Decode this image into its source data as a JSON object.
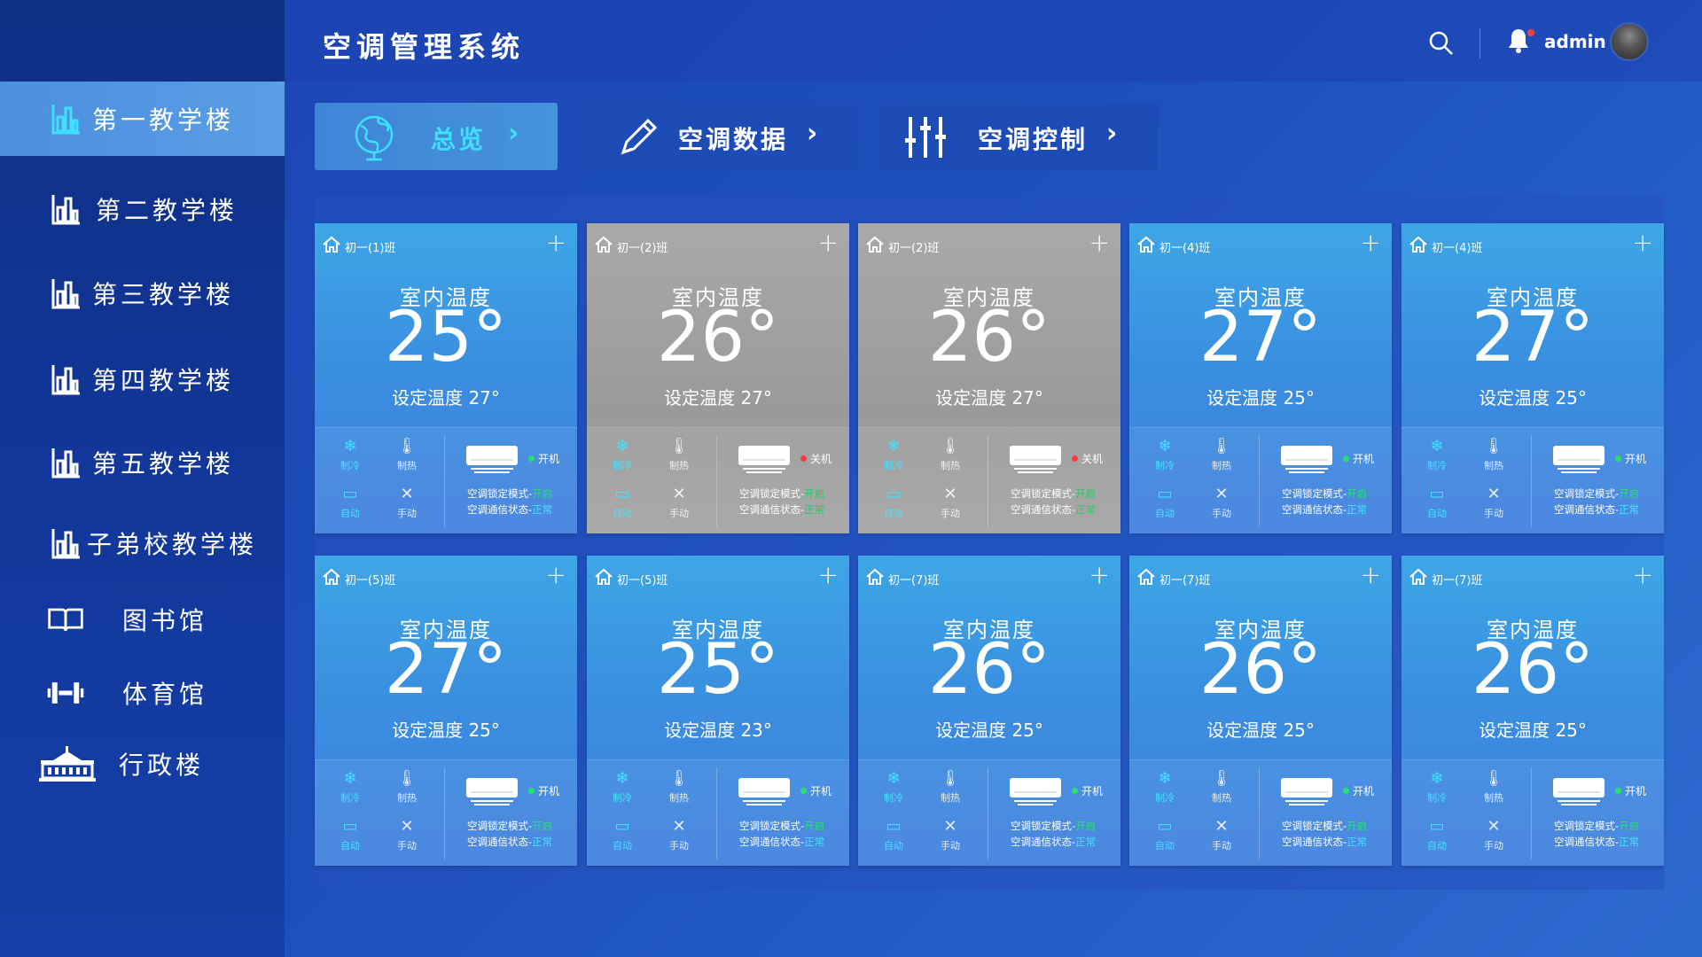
{
  "app": {
    "title": "空调管理系统",
    "user": "admin"
  },
  "sidebar": {
    "items": [
      {
        "label": "第一教学楼",
        "icon": "bar-chart-icon",
        "active": true
      },
      {
        "label": "第二教学楼",
        "icon": "bar-chart-icon"
      },
      {
        "label": "第三教学楼",
        "icon": "bar-chart-icon"
      },
      {
        "label": "第四教学楼",
        "icon": "bar-chart-icon"
      },
      {
        "label": "第五教学楼",
        "icon": "bar-chart-icon"
      },
      {
        "label": "子弟校教学楼",
        "icon": "bar-chart-icon"
      },
      {
        "label": "图书馆",
        "icon": "book-icon"
      },
      {
        "label": "体育馆",
        "icon": "dumbbell-icon"
      },
      {
        "label": "行政楼",
        "icon": "building-icon"
      }
    ]
  },
  "tabs": [
    {
      "label": "总览",
      "icon": "globe-icon",
      "active": true
    },
    {
      "label": "空调数据",
      "icon": "pencil-icon"
    },
    {
      "label": "空调控制",
      "icon": "sliders-icon"
    }
  ],
  "card_labels": {
    "indoor": "室内温度",
    "set_prefix": "设定温度",
    "cool": "制冷",
    "heat": "制热",
    "auto": "自动",
    "manual": "手动",
    "lock_prefix": "空调锁定模式-",
    "lock_value": "开启",
    "comm_prefix": "空调通信状态-",
    "comm_value": "正常"
  },
  "cards": [
    {
      "class": "初一(1)班",
      "temp": "25°",
      "set": "27°",
      "power": "开机",
      "on": true
    },
    {
      "class": "初一(2)班",
      "temp": "26°",
      "set": "27°",
      "power": "关机",
      "on": false
    },
    {
      "class": "初一(2)班",
      "temp": "26°",
      "set": "27°",
      "power": "关机",
      "on": false
    },
    {
      "class": "初一(4)班",
      "temp": "27°",
      "set": "25°",
      "power": "开机",
      "on": true
    },
    {
      "class": "初一(4)班",
      "temp": "27°",
      "set": "25°",
      "power": "开机",
      "on": true
    },
    {
      "class": "初一(5)班",
      "temp": "27°",
      "set": "25°",
      "power": "开机",
      "on": true
    },
    {
      "class": "初一(5)班",
      "temp": "25°",
      "set": "23°",
      "power": "开机",
      "on": true
    },
    {
      "class": "初一(7)班",
      "temp": "26°",
      "set": "25°",
      "power": "开机",
      "on": true
    },
    {
      "class": "初一(7)班",
      "temp": "26°",
      "set": "25°",
      "power": "开机",
      "on": true
    },
    {
      "class": "初一(7)班",
      "temp": "26°",
      "set": "25°",
      "power": "开机",
      "on": true
    }
  ],
  "colors": {
    "accent_cyan": "#3fe0ff",
    "status_on": "#26e06f",
    "status_off": "#ff3b3b",
    "card_on": "#3a8fe0",
    "card_off": "#9a9a9a"
  }
}
